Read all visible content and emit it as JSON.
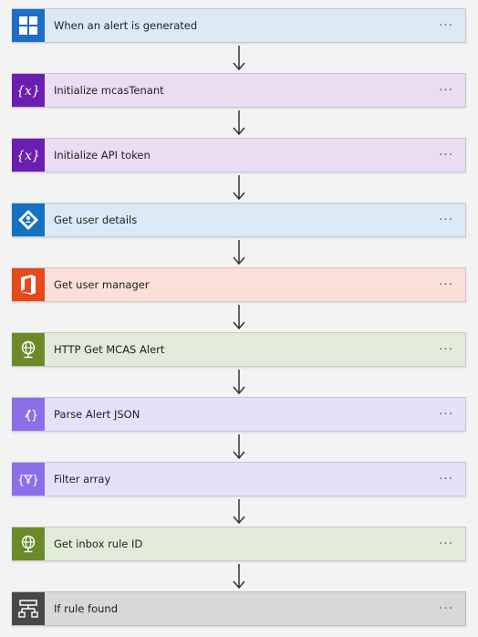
{
  "steps": [
    {
      "label": "When an alert is generated",
      "icon": "windows-grid-icon",
      "bg": "#dbe9f6",
      "iconbg": "#1d6ec4"
    },
    {
      "label": "Initialize mcasTenant",
      "icon": "variable-icon",
      "bg": "#eadcf3",
      "iconbg": "#6b1fb0"
    },
    {
      "label": "Initialize API token",
      "icon": "variable-icon",
      "bg": "#eadcf3",
      "iconbg": "#6b1fb0"
    },
    {
      "label": "Get user details",
      "icon": "azure-ad-icon",
      "bg": "#dbe9f6",
      "iconbg": "#1572c0"
    },
    {
      "label": "Get user manager",
      "icon": "office-icon",
      "bg": "#fbe0d9",
      "iconbg": "#e6491c"
    },
    {
      "label": "HTTP Get MCAS Alert",
      "icon": "http-globe-icon",
      "bg": "#e4ead9",
      "iconbg": "#6b8a2a"
    },
    {
      "label": "Parse Alert JSON",
      "icon": "data-operation-icon",
      "bg": "#e6e0f8",
      "iconbg": "#8c6fe8"
    },
    {
      "label": "Filter array",
      "icon": "filter-icon",
      "bg": "#e6e0f8",
      "iconbg": "#8c6fe8"
    },
    {
      "label": "Get inbox rule ID",
      "icon": "http-globe-icon",
      "bg": "#e4ead9",
      "iconbg": "#6b8a2a"
    },
    {
      "label": "If rule found",
      "icon": "condition-icon",
      "bg": "#d8d8d8",
      "iconbg": "#484848"
    }
  ],
  "more_label": "···"
}
